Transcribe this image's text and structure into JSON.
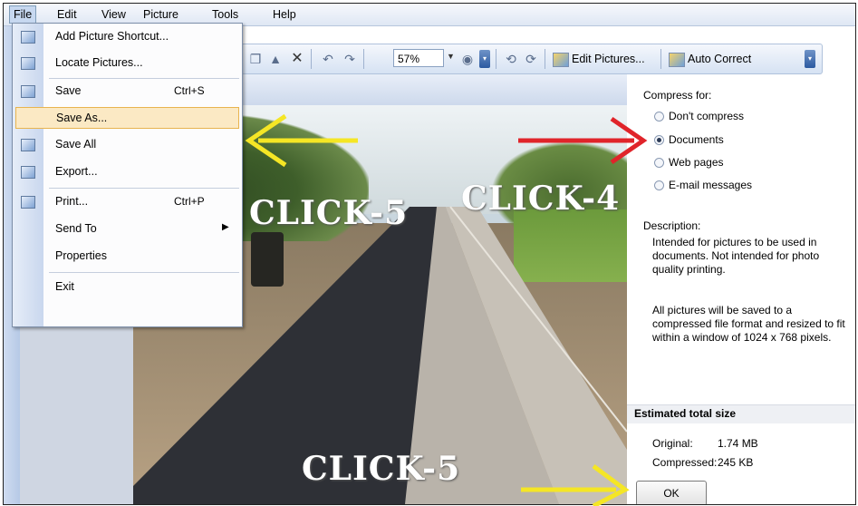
{
  "menubar": {
    "items": [
      {
        "label": "File",
        "active": true
      },
      {
        "label": "Edit"
      },
      {
        "label": "View"
      },
      {
        "label": "Picture"
      },
      {
        "label": "Tools"
      },
      {
        "label": "Help"
      }
    ]
  },
  "toolbar": {
    "zoom": "57%",
    "edit_pictures": "Edit Pictures...",
    "auto_correct": "Auto Correct"
  },
  "file_menu": {
    "items": [
      {
        "label": "Add Picture Shortcut...",
        "icon": "add-shortcut-icon"
      },
      {
        "label": "Locate Pictures...",
        "icon": "locate-icon"
      },
      {
        "label": "Save",
        "shortcut": "Ctrl+S",
        "icon": "save-icon"
      },
      {
        "label": "Save As...",
        "highlighted": true
      },
      {
        "label": "Save All",
        "icon": "save-all-icon"
      },
      {
        "label": "Export...",
        "icon": "export-icon"
      },
      {
        "label": "Print...",
        "shortcut": "Ctrl+P",
        "icon": "print-icon"
      },
      {
        "label": "Send To",
        "submenu": true
      },
      {
        "label": "Properties"
      },
      {
        "label": "Exit"
      }
    ]
  },
  "compress": {
    "title": "Compress for:",
    "options": [
      {
        "label": "Don't compress",
        "selected": false
      },
      {
        "label": "Documents",
        "selected": true
      },
      {
        "label": "Web pages",
        "selected": false
      },
      {
        "label": "E-mail messages",
        "selected": false
      }
    ],
    "description_title": "Description:",
    "description_1": "Intended for pictures to be used in documents. Not intended for photo quality printing.",
    "description_2": "All pictures will be saved to a compressed file format and resized to fit within a window of 1024 x 768 pixels.",
    "estimated_title": "Estimated total size",
    "original_label": "Original:",
    "original_value": "1.74 MB",
    "compressed_label": "Compressed:",
    "compressed_value": "245 KB",
    "ok_label": "OK"
  },
  "annotations": {
    "click_left": "CLICK-5",
    "click_right": "CLICK-4",
    "click_bottom": "CLICK-5",
    "colors": {
      "yellow_arrow": "#f5e625",
      "red_arrow": "#e0242a"
    }
  }
}
